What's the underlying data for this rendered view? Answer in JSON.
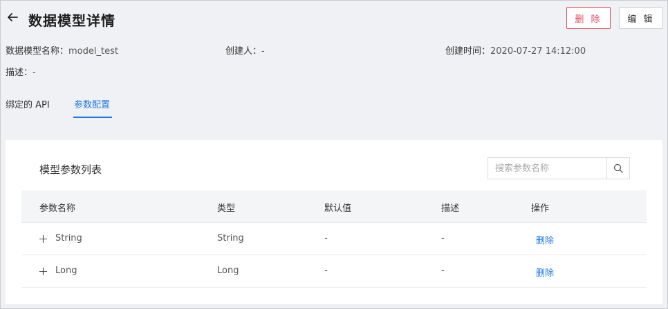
{
  "header": {
    "title": "数据模型详情",
    "delete_label": "删 除",
    "edit_label": "编 辑"
  },
  "meta": {
    "name_label": "数据模型名称：",
    "name_value": "model_test",
    "creator_label": "创建人：",
    "creator_value": "-",
    "created_time_label": "创建时间：",
    "created_time_value": "2020-07-27 14:12:00",
    "desc_label": "描述：",
    "desc_value": "-"
  },
  "tabs": [
    {
      "label": "绑定的 API",
      "active": false
    },
    {
      "label": "参数配置",
      "active": true
    }
  ],
  "param_list": {
    "title": "模型参数列表",
    "search_placeholder": "搜索参数名称",
    "columns": [
      "参数名称",
      "类型",
      "默认值",
      "描述",
      "操作"
    ],
    "rows": [
      {
        "name": "String",
        "type": "String",
        "default": "-",
        "desc": "-",
        "action": "删除"
      },
      {
        "name": "Long",
        "type": "Long",
        "default": "-",
        "desc": "-",
        "action": "删除"
      }
    ]
  },
  "colors": {
    "accent": "#1a79e6",
    "danger": "#e34d59",
    "background": "#f0f1f4"
  },
  "icons": [
    "arrow-left-icon",
    "search-icon",
    "plus-square-icon"
  ]
}
